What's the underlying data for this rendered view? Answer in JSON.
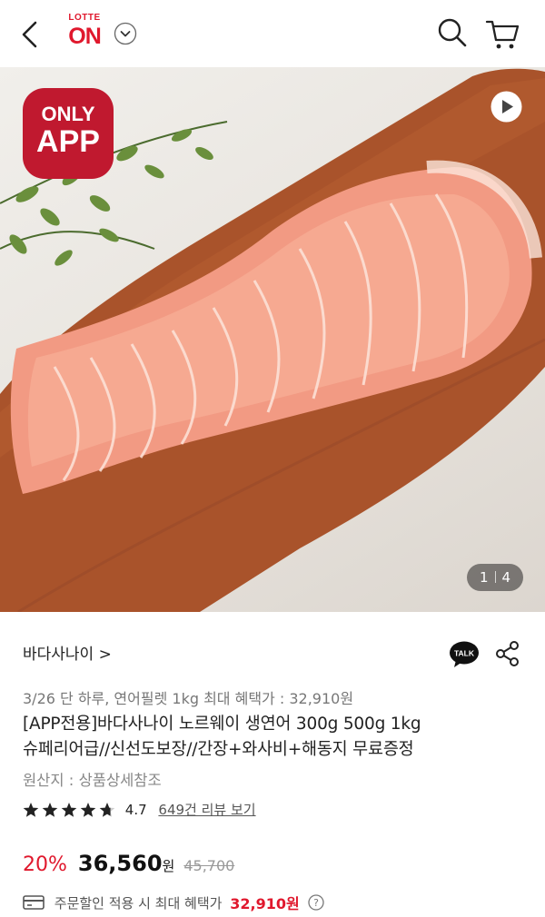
{
  "header": {
    "logo_top": "LOTTE",
    "logo_main": "ON"
  },
  "hero": {
    "badge_line1": "ONLY",
    "badge_line2": "APP",
    "counter_current": "1",
    "counter_total": "4"
  },
  "product": {
    "seller": "바다사나이 >",
    "promo": "3/26 단 하루, 연어필렛 1kg 최대 혜택가 : 32,910원",
    "title_line1": "[APP전용]바다사나이 노르웨이 생연어 300g 500g 1kg",
    "title_line2": "슈페리어급//신선도보장//간장+와사비+해동지 무료증정",
    "origin": "원산지 : 상품상세참조",
    "rating_value": 4.7,
    "rating_text": "4.7",
    "reviews_link": "649건 리뷰 보기",
    "discount": "20%",
    "price": "36,560",
    "price_unit": "원",
    "original_price": "45,700",
    "benefit_text": "주문할인 적용 시 최대 혜택가",
    "benefit_amount": "32,910원"
  },
  "colors": {
    "brand_red": "#e0182d",
    "badge_red": "#c0192f"
  },
  "icons": [
    "back-arrow-icon",
    "chevron-down-icon",
    "search-icon",
    "cart-icon",
    "play-icon",
    "talk-icon",
    "share-icon",
    "star-icon",
    "card-icon",
    "help-icon"
  ]
}
